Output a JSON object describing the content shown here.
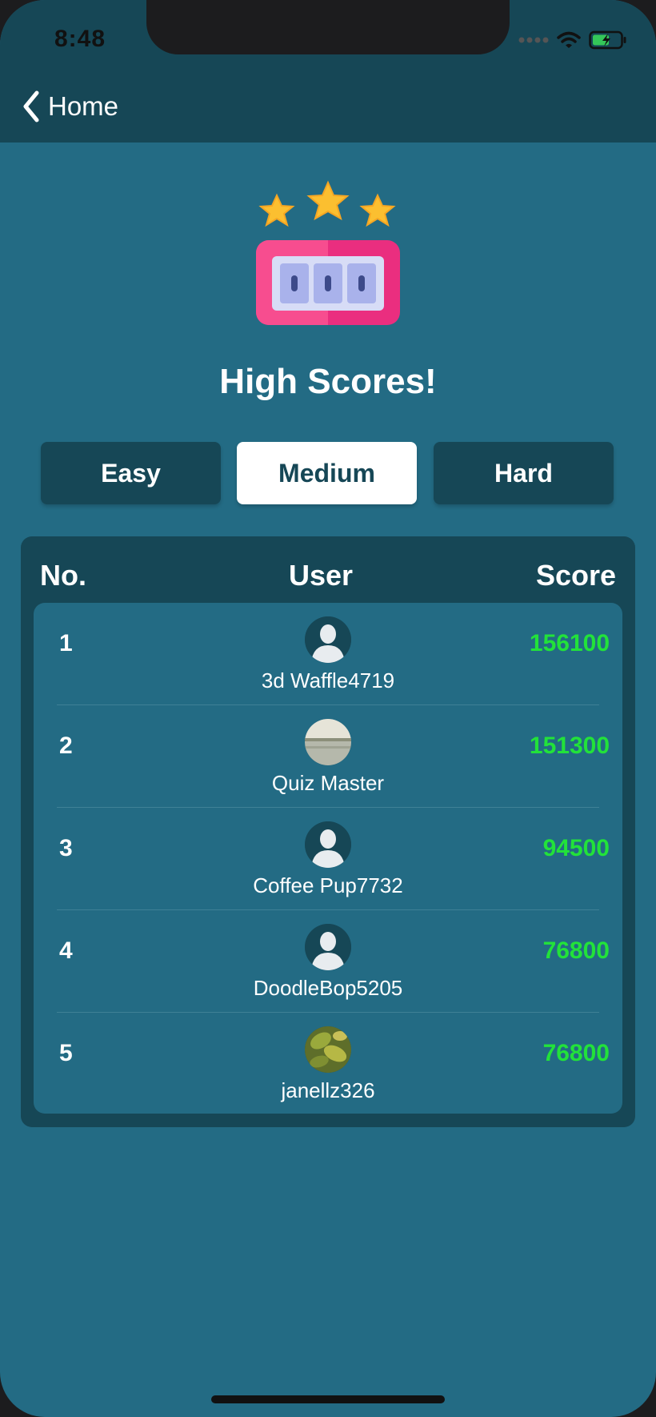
{
  "status_bar": {
    "time": "8:48",
    "signal": "signal-dots-icon",
    "wifi": "wifi-icon",
    "battery": "battery-charging-icon"
  },
  "nav": {
    "back_label": "Home",
    "back_icon": "chevron-left-icon"
  },
  "hero": {
    "icon": "slot-machine-stars-icon"
  },
  "title": "High Scores!",
  "tabs": [
    {
      "label": "Easy",
      "active": false
    },
    {
      "label": "Medium",
      "active": true
    },
    {
      "label": "Hard",
      "active": false
    }
  ],
  "table": {
    "headers": {
      "no": "No.",
      "user": "User",
      "score": "Score"
    },
    "rows": [
      {
        "rank": "1",
        "user": "3d Waffle4719",
        "score": "156100",
        "avatar": "default-user-icon"
      },
      {
        "rank": "2",
        "user": "Quiz Master",
        "score": "151300",
        "avatar": "lake-photo-avatar"
      },
      {
        "rank": "3",
        "user": "Coffee Pup7732",
        "score": "94500",
        "avatar": "default-user-icon"
      },
      {
        "rank": "4",
        "user": "DoodleBop5205",
        "score": "76800",
        "avatar": "default-user-icon"
      },
      {
        "rank": "5",
        "user": "janellz326",
        "score": "76800",
        "avatar": "leaf-photo-avatar"
      }
    ]
  },
  "colors": {
    "background": "#236b84",
    "header": "#164756",
    "score": "#22e23a",
    "active_tab": "#ffffff"
  }
}
